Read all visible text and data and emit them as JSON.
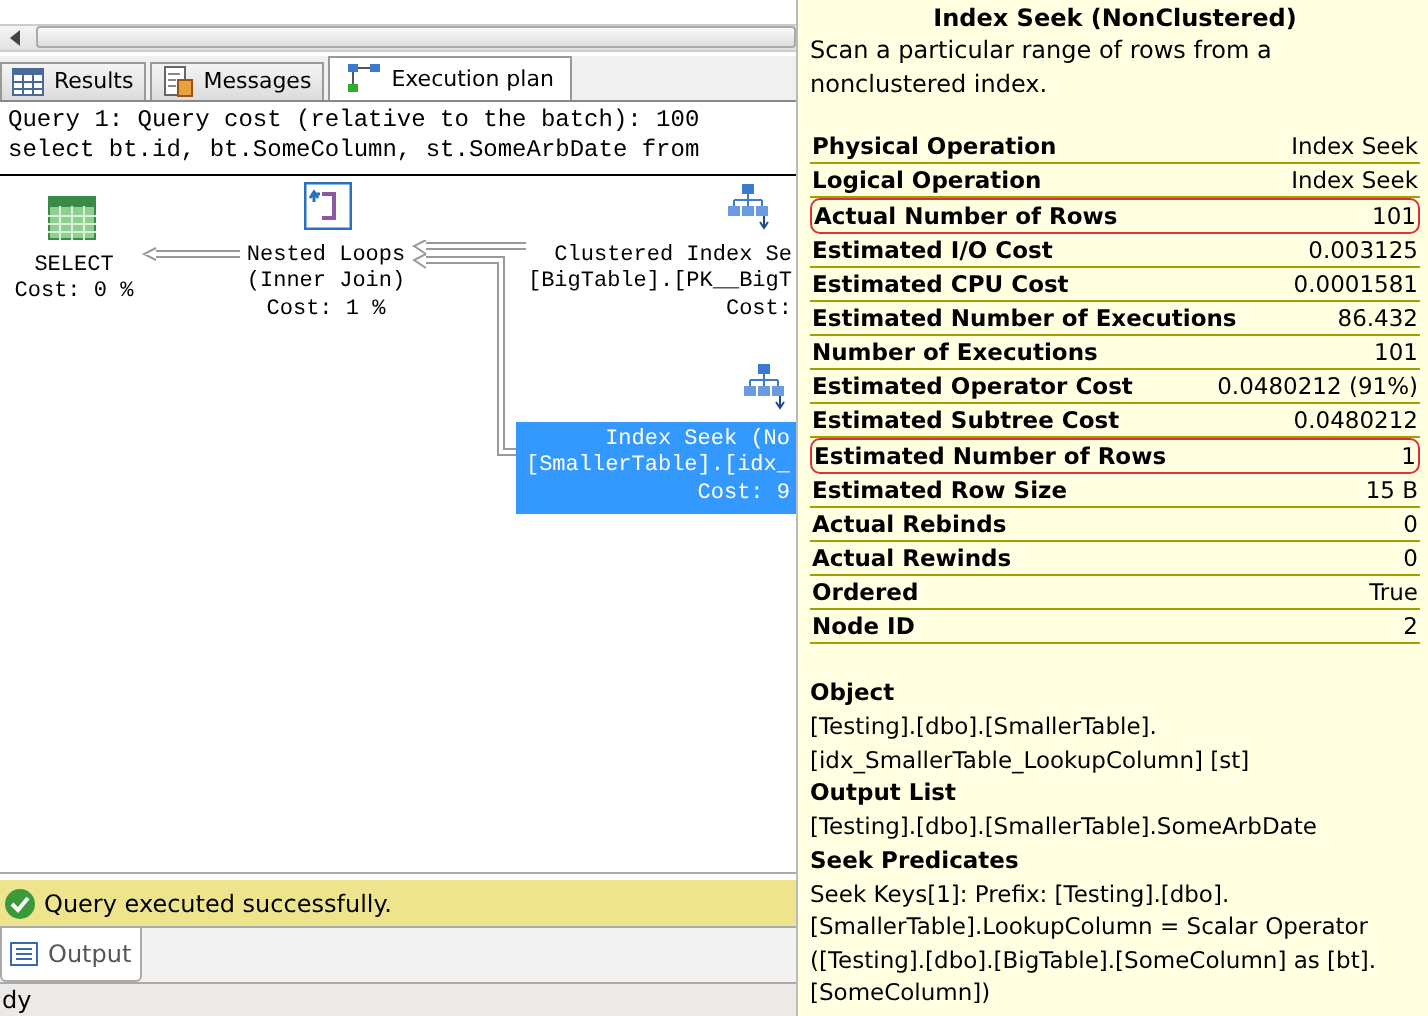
{
  "tabs": [
    {
      "label": "Results",
      "kind": "grid",
      "selected": false
    },
    {
      "label": "Messages",
      "kind": "document",
      "selected": false
    },
    {
      "label": "Execution plan",
      "kind": "plan",
      "selected": true
    }
  ],
  "query_lines": [
    "Query 1: Query cost (relative to the batch): 100",
    "select bt.id, bt.SomeColumn, st.SomeArbDate from"
  ],
  "plan": {
    "nodes": [
      {
        "kind": "select",
        "lines": [
          "SELECT",
          "Cost: 0 %"
        ],
        "selected": false
      },
      {
        "kind": "nested-loops",
        "lines": [
          "Nested Loops",
          "(Inner Join)",
          "Cost: 1 %"
        ],
        "selected": false
      },
      {
        "kind": "clustered-index-seek",
        "lines": [
          "Clustered Index Se",
          "[BigTable].[PK__BigT",
          "Cost:"
        ],
        "selected": false
      },
      {
        "kind": "index-seek",
        "lines": [
          "Index Seek (No",
          "[SmallerTable].[idx_",
          "Cost: 9"
        ],
        "selected": true
      }
    ]
  },
  "status": {
    "message": "Query executed successfully.",
    "succeeded": true
  },
  "output_tab": {
    "label": "Output"
  },
  "status_bar": {
    "text": "dy"
  },
  "tooltip": {
    "title": "Index Seek (NonClustered)",
    "description": "Scan a particular range of rows from a nonclustered index.",
    "properties": [
      {
        "name": "Physical Operation",
        "value": "Index Seek",
        "highlighted": false
      },
      {
        "name": "Logical Operation",
        "value": "Index Seek",
        "highlighted": false
      },
      {
        "name": "Actual Number of Rows",
        "value": "101",
        "highlighted": true
      },
      {
        "name": "Estimated I/O Cost",
        "value": "0.003125",
        "highlighted": false
      },
      {
        "name": "Estimated CPU Cost",
        "value": "0.0001581",
        "highlighted": false
      },
      {
        "name": "Estimated Number of Executions",
        "value": "86.432",
        "highlighted": false
      },
      {
        "name": "Number of Executions",
        "value": "101",
        "highlighted": false
      },
      {
        "name": "Estimated Operator Cost",
        "value": "0.0480212 (91%)",
        "highlighted": false
      },
      {
        "name": "Estimated Subtree Cost",
        "value": "0.0480212",
        "highlighted": false
      },
      {
        "name": "Estimated Number of Rows",
        "value": "1",
        "highlighted": true
      },
      {
        "name": "Estimated Row Size",
        "value": "15 B",
        "highlighted": false
      },
      {
        "name": "Actual Rebinds",
        "value": "0",
        "highlighted": false
      },
      {
        "name": "Actual Rewinds",
        "value": "0",
        "highlighted": false
      },
      {
        "name": "Ordered",
        "value": "True",
        "highlighted": false
      },
      {
        "name": "Node ID",
        "value": "2",
        "highlighted": false
      }
    ],
    "sections": [
      {
        "heading": "Object",
        "lines": [
          "[Testing].[dbo].[SmallerTable].",
          "[idx_SmallerTable_LookupColumn] [st]"
        ]
      },
      {
        "heading": "Output List",
        "lines": [
          "[Testing].[dbo].[SmallerTable].SomeArbDate"
        ]
      },
      {
        "heading": "Seek Predicates",
        "lines": [
          "Seek Keys[1]: Prefix: [Testing].[dbo].",
          "[SmallerTable].LookupColumn = Scalar Operator",
          "([Testing].[dbo].[BigTable].[SomeColumn] as [bt].",
          "[SomeColumn])"
        ]
      }
    ]
  }
}
